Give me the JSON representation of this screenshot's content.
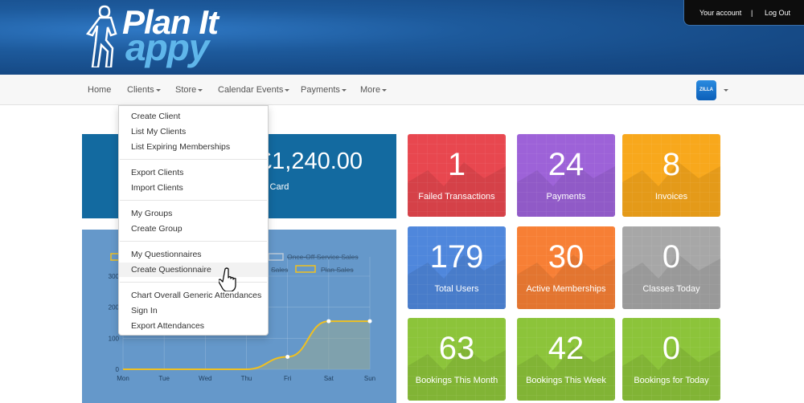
{
  "header": {
    "logo": {
      "line1": "Plan It",
      "line2": "appy"
    },
    "account": {
      "your_account": "Your account",
      "separator": "|",
      "logout": "Log Out"
    }
  },
  "nav": {
    "items": [
      {
        "label": "Home",
        "has_caret": false
      },
      {
        "label": "Clients",
        "has_caret": true
      },
      {
        "label": "Store",
        "has_caret": true
      },
      {
        "label": "Calendar Events",
        "has_caret": true
      },
      {
        "label": "Payments",
        "has_caret": true
      },
      {
        "label": "More",
        "has_caret": true
      }
    ],
    "user_badge": "ZILLA"
  },
  "clients_menu": {
    "groups": [
      [
        "Create Client",
        "List My Clients",
        "List Expiring Memberships"
      ],
      [
        "Export Clients",
        "Import Clients"
      ],
      [
        "My Groups",
        "Create Group"
      ],
      [
        "My Questionnaires",
        "Create Questionnaire"
      ],
      [
        "Chart Overall Generic Attendances",
        "Sign In",
        "Export Attendances"
      ]
    ],
    "hovered": "Create Questionnaire"
  },
  "revenue": {
    "amount": "£1,240.00",
    "label": "it Card"
  },
  "stat_tiles": [
    {
      "value": "1",
      "label": "Failed Transactions",
      "color": "#e8474f"
    },
    {
      "value": "24",
      "label": "Payments",
      "color": "#9d62d8"
    },
    {
      "value": "8",
      "label": "Invoices",
      "color": "#f8a81c"
    },
    {
      "value": "179",
      "label": "Total Users",
      "color": "#4f87dc"
    },
    {
      "value": "30",
      "label": "Active Memberships",
      "color": "#f77f35"
    },
    {
      "value": "0",
      "label": "Classes Today",
      "color": "#a7a7a7"
    },
    {
      "value": "63",
      "label": "Bookings This Month",
      "color": "#8cc43a"
    },
    {
      "value": "42",
      "label": "Bookings This Week",
      "color": "#8cc43a"
    },
    {
      "value": "0",
      "label": "Bookings for Today",
      "color": "#8cc43a"
    }
  ],
  "chart_data": {
    "type": "line",
    "categories": [
      "Mon",
      "Tue",
      "Wed",
      "Thu",
      "Fri",
      "Sat",
      "Sun"
    ],
    "yticks": [
      "0",
      "100",
      "200",
      "300"
    ],
    "ylim": [
      0,
      300
    ],
    "legend": [
      "Once-Off Service Sales",
      "Plan Sales"
    ],
    "partial_legend_text": "Sales",
    "series": [
      {
        "name": "Plan Sales",
        "values": [
          0,
          0,
          0,
          0,
          40,
          155,
          155
        ]
      }
    ],
    "grid": true
  }
}
